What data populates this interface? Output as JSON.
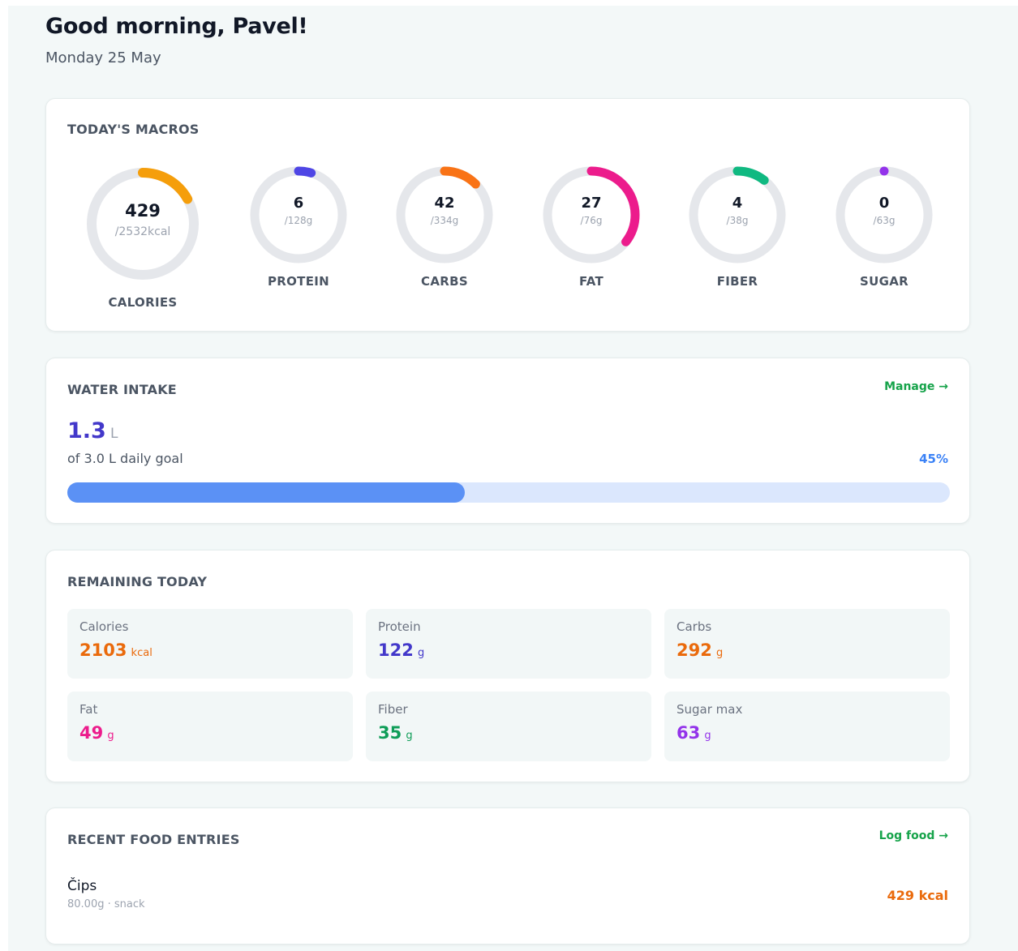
{
  "header": {
    "greeting": "Good morning, Pavel!",
    "date": "Monday 25 May"
  },
  "macros": {
    "title": "TODAY'S MACROS",
    "items": [
      {
        "key": "calories",
        "value": "429",
        "goal": "/2532kcal",
        "label": "CALORIES",
        "current": 429,
        "target": 2532,
        "color": "#f59e0b"
      },
      {
        "key": "protein",
        "value": "6",
        "goal": "/128g",
        "label": "PROTEIN",
        "current": 6,
        "target": 128,
        "color": "#4f46e5"
      },
      {
        "key": "carbs",
        "value": "42",
        "goal": "/334g",
        "label": "CARBS",
        "current": 42,
        "target": 334,
        "color": "#f97316"
      },
      {
        "key": "fat",
        "value": "27",
        "goal": "/76g",
        "label": "FAT",
        "current": 27,
        "target": 76,
        "color": "#ec1c8c"
      },
      {
        "key": "fiber",
        "value": "4",
        "goal": "/38g",
        "label": "FIBER",
        "current": 4,
        "target": 38,
        "color": "#10b981"
      },
      {
        "key": "sugar",
        "value": "0",
        "goal": "/63g",
        "label": "SUGAR",
        "current": 0,
        "target": 63,
        "color": "#9333ea"
      }
    ],
    "track_color": "#e5e7eb"
  },
  "water": {
    "title": "WATER INTAKE",
    "manage_label": "Manage →",
    "amount": "1.3",
    "unit": "L",
    "subtitle": "of 3.0 L daily goal",
    "percent_label": "45%",
    "percent": 45
  },
  "remaining": {
    "title": "REMAINING TODAY",
    "tiles": [
      {
        "label": "Calories",
        "value": "2103",
        "unit": "kcal",
        "color": "#ea6a0c"
      },
      {
        "label": "Protein",
        "value": "122",
        "unit": "g",
        "color": "#4338ca"
      },
      {
        "label": "Carbs",
        "value": "292",
        "unit": "g",
        "color": "#ea6a0c"
      },
      {
        "label": "Fat",
        "value": "49",
        "unit": "g",
        "color": "#ec1c8c"
      },
      {
        "label": "Fiber",
        "value": "35",
        "unit": "g",
        "color": "#0f9d58"
      },
      {
        "label": "Sugar max",
        "value": "63",
        "unit": "g",
        "color": "#9333ea"
      }
    ]
  },
  "recent": {
    "title": "RECENT FOOD ENTRIES",
    "log_label": "Log food →",
    "entries": [
      {
        "name": "Čips",
        "meta": "80.00g · snack",
        "kcal": "429 kcal"
      }
    ]
  }
}
